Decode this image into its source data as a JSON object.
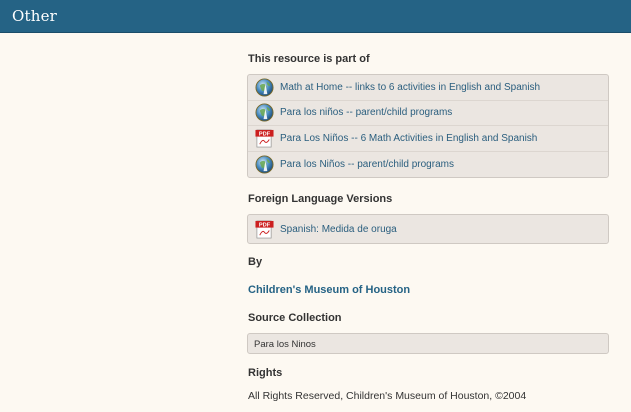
{
  "header": {
    "title": "Other"
  },
  "resource_part_of": {
    "heading": "This resource is part of",
    "items": [
      {
        "label": "Math at Home -- links to 6 activities in English and Spanish",
        "icon": "globe-icon"
      },
      {
        "label": "Para los niños -- parent/child programs",
        "icon": "globe-icon"
      },
      {
        "label": "Para Los Niños -- 6 Math Activities in English and Spanish",
        "icon": "pdf-icon"
      },
      {
        "label": "Para los Niños -- parent/child programs",
        "icon": "globe-icon"
      }
    ]
  },
  "foreign_language": {
    "heading": "Foreign Language Versions",
    "items": [
      {
        "label": "Spanish: Medida de oruga",
        "icon": "pdf-icon"
      }
    ]
  },
  "by": {
    "heading": "By",
    "author": "Children's Museum of Houston"
  },
  "source_collection": {
    "heading": "Source Collection",
    "value": "Para los Ninos"
  },
  "rights": {
    "heading": "Rights",
    "text": "All Rights Reserved, Children's Museum of Houston, ©2004"
  },
  "colors": {
    "header_bg": "#256385",
    "page_bg": "#fdf9f2",
    "link": "#2a5e7e",
    "box_bg": "#ebe6e1"
  }
}
